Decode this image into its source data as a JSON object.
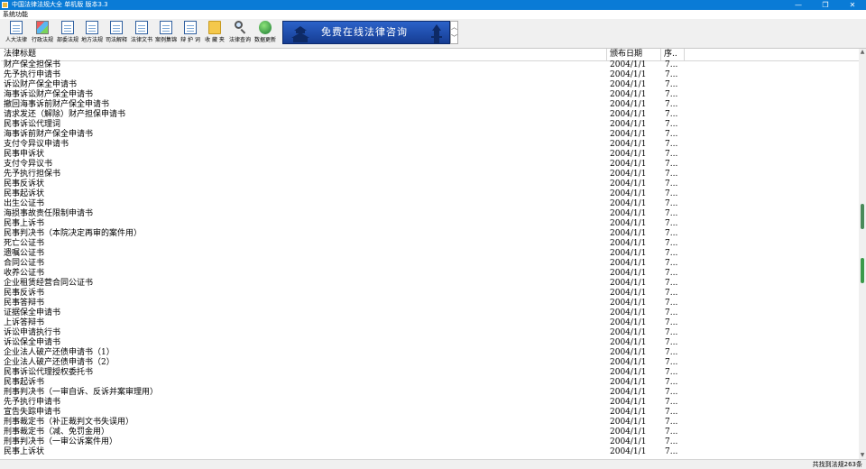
{
  "window": {
    "title": "中国法律法规大全 单机版 版本3.3",
    "buttons": {
      "minimize": "—",
      "maximize": "❐",
      "close": "✕"
    }
  },
  "menu": {
    "items": [
      "系统功能"
    ]
  },
  "toolbar": {
    "items": [
      {
        "label": "人大法律",
        "icon": "document-icon"
      },
      {
        "label": "行政法规",
        "icon": "colorful-book-icon"
      },
      {
        "label": "部委法规",
        "icon": "pencil-document-icon"
      },
      {
        "label": "地方法规",
        "icon": "edit-document-icon"
      },
      {
        "label": "司法解释",
        "icon": "page-icon"
      },
      {
        "label": "法律文书",
        "icon": "document-stack-icon"
      },
      {
        "label": "案例集锦",
        "icon": "notebook-icon"
      },
      {
        "label": "辩 护 词",
        "icon": "document-pen-icon"
      },
      {
        "label": "收 藏 夹",
        "icon": "folder-icon"
      },
      {
        "label": "法律查询",
        "icon": "magnifier-icon"
      },
      {
        "label": "数据更新",
        "icon": "globe-icon"
      }
    ],
    "banner_text": "免费在线法律咨询",
    "spinner": {
      "up": "︿",
      "down": "﹀"
    }
  },
  "table": {
    "columns": [
      "法律标题",
      "颁布日期",
      "序.."
    ],
    "rows": [
      [
        "财产保全担保书",
        "2004/1/1",
        "7..."
      ],
      [
        "先予执行申请书",
        "2004/1/1",
        "7..."
      ],
      [
        "诉讼财产保全申请书",
        "2004/1/1",
        "7..."
      ],
      [
        "海事诉讼财产保全申请书",
        "2004/1/1",
        "7..."
      ],
      [
        "撤回海事诉前财产保全申请书",
        "2004/1/1",
        "7..."
      ],
      [
        "请求发还（解除）财产担保申请书",
        "2004/1/1",
        "7..."
      ],
      [
        "民事诉讼代理词",
        "2004/1/1",
        "7..."
      ],
      [
        "海事诉前财产保全申请书",
        "2004/1/1",
        "7..."
      ],
      [
        "支付令异议申请书",
        "2004/1/1",
        "7..."
      ],
      [
        "民事申诉状",
        "2004/1/1",
        "7..."
      ],
      [
        "支付令异议书",
        "2004/1/1",
        "7..."
      ],
      [
        "先予执行担保书",
        "2004/1/1",
        "7..."
      ],
      [
        "民事反诉状",
        "2004/1/1",
        "7..."
      ],
      [
        "民事起诉状",
        "2004/1/1",
        "7..."
      ],
      [
        "出生公证书",
        "2004/1/1",
        "7..."
      ],
      [
        "海损事故责任限制申请书",
        "2004/1/1",
        "7..."
      ],
      [
        "民事上诉书",
        "2004/1/1",
        "7..."
      ],
      [
        "民事判决书（本院决定再审的案件用）",
        "2004/1/1",
        "7..."
      ],
      [
        "死亡公证书",
        "2004/1/1",
        "7..."
      ],
      [
        "遗嘱公证书",
        "2004/1/1",
        "7..."
      ],
      [
        "合同公证书",
        "2004/1/1",
        "7..."
      ],
      [
        "收养公证书",
        "2004/1/1",
        "7..."
      ],
      [
        "企业租赁经营合同公证书",
        "2004/1/1",
        "7..."
      ],
      [
        "民事反诉书",
        "2004/1/1",
        "7..."
      ],
      [
        "民事答辩书",
        "2004/1/1",
        "7..."
      ],
      [
        "证据保全申请书",
        "2004/1/1",
        "7..."
      ],
      [
        "上诉答辩书",
        "2004/1/1",
        "7..."
      ],
      [
        "诉讼申请执行书",
        "2004/1/1",
        "7..."
      ],
      [
        "诉讼保全申请书",
        "2004/1/1",
        "7..."
      ],
      [
        "企业法人破产还债申请书（1）",
        "2004/1/1",
        "7..."
      ],
      [
        "企业法人破产还债申请书（2）",
        "2004/1/1",
        "7..."
      ],
      [
        "民事诉讼代理授权委托书",
        "2004/1/1",
        "7..."
      ],
      [
        "民事起诉书",
        "2004/1/1",
        "7..."
      ],
      [
        "刑事判决书（一审自诉、反诉并案审理用）",
        "2004/1/1",
        "7..."
      ],
      [
        "先予执行申请书",
        "2004/1/1",
        "7..."
      ],
      [
        "宣告失踪申请书",
        "2004/1/1",
        "7..."
      ],
      [
        "刑事裁定书（补正裁判文书失误用）",
        "2004/1/1",
        "7..."
      ],
      [
        "刑事裁定书（减、免罚金用）",
        "2004/1/1",
        "7..."
      ],
      [
        "刑事判决书（一审公诉案件用）",
        "2004/1/1",
        "7..."
      ],
      [
        "民事上诉状",
        "2004/1/1",
        "7..."
      ]
    ]
  },
  "scrollbar": {
    "colors": {
      "thumb_primary": "#4a8a5a",
      "thumb_secondary": "#3b9a4a"
    }
  },
  "status": {
    "text": "共找到法规263条"
  },
  "colors": {
    "titlebar": "#0a7bd6",
    "banner": "#1f4fae"
  }
}
